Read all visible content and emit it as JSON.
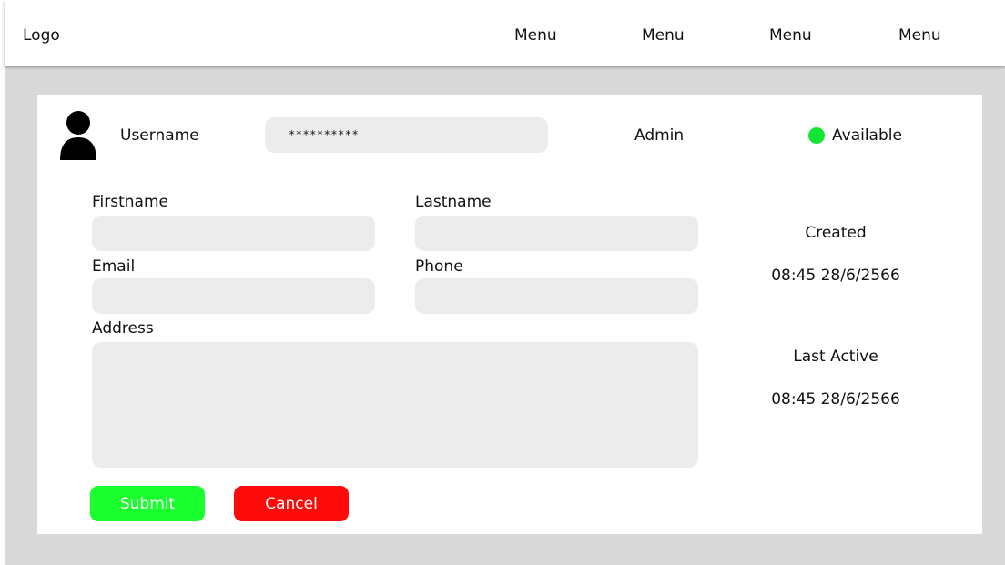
{
  "header": {
    "logo": "Logo",
    "menu": [
      "Menu",
      "Menu",
      "Menu",
      "Menu"
    ]
  },
  "user": {
    "avatar_icon": "user-icon",
    "username_label": "Username",
    "password_value": "**********",
    "role": "Admin",
    "status": "Available",
    "status_color": "#13e534"
  },
  "form": {
    "firstname_label": "Firstname",
    "firstname_value": "",
    "lastname_label": "Lastname",
    "lastname_value": "",
    "email_label": "Email",
    "email_value": "",
    "phone_label": "Phone",
    "phone_value": "",
    "address_label": "Address",
    "address_value": ""
  },
  "meta": {
    "created_label": "Created",
    "created_value": "08:45 28/6/2566",
    "last_active_label": "Last Active",
    "last_active_value": "08:45 28/6/2566"
  },
  "actions": {
    "submit_label": "Submit",
    "submit_color": "#19ff2e",
    "cancel_label": "Cancel",
    "cancel_color": "#ff0a0a"
  }
}
